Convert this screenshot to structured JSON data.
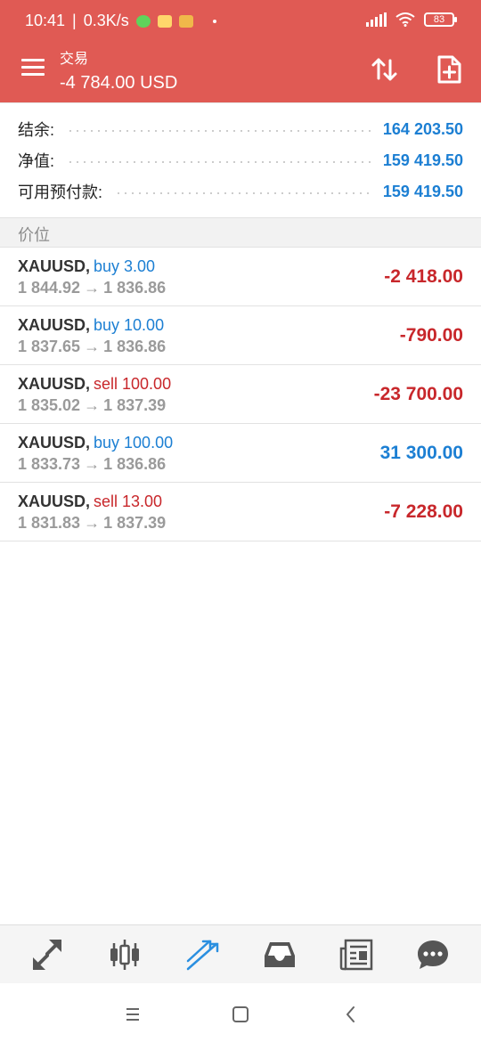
{
  "status_bar": {
    "time": "10:41",
    "speed": "0.3K/s",
    "battery": "83"
  },
  "header": {
    "title": "交易",
    "profit": "-4 784.00 USD",
    "icons": [
      "menu-icon",
      "sort-arrows-icon",
      "new-order-icon"
    ]
  },
  "summary": {
    "rows": [
      {
        "label": "结余:",
        "value": "164 203.50"
      },
      {
        "label": "净值:",
        "value": "159 419.50"
      },
      {
        "label": "可用预付款:",
        "value": "159 419.50"
      }
    ]
  },
  "section": {
    "title": "价位"
  },
  "positions": [
    {
      "symbol": "XAUUSD,",
      "type": "buy 3.00",
      "direction": "buy",
      "open": "1 844.92",
      "current": "1 836.86",
      "profit": "-2 418.00",
      "profit_sign": "negative"
    },
    {
      "symbol": "XAUUSD,",
      "type": "buy 10.00",
      "direction": "buy",
      "open": "1 837.65",
      "current": "1 836.86",
      "profit": "-790.00",
      "profit_sign": "negative"
    },
    {
      "symbol": "XAUUSD,",
      "type": "sell 100.00",
      "direction": "sell",
      "open": "1 835.02",
      "current": "1 837.39",
      "profit": "-23 700.00",
      "profit_sign": "negative"
    },
    {
      "symbol": "XAUUSD,",
      "type": "buy 100.00",
      "direction": "buy",
      "open": "1 833.73",
      "current": "1 836.86",
      "profit": "31 300.00",
      "profit_sign": "positive"
    },
    {
      "symbol": "XAUUSD,",
      "type": "sell 13.00",
      "direction": "sell",
      "open": "1 831.83",
      "current": "1 837.39",
      "profit": "-7 228.00",
      "profit_sign": "negative"
    }
  ],
  "arrow_glyph": "→",
  "bottom_nav": {
    "items": [
      "quotes-icon",
      "chart-candlestick-icon",
      "trade-icon",
      "inbox-icon",
      "news-icon",
      "chat-icon"
    ],
    "active": "trade-icon"
  },
  "colors": {
    "header": "#e05a54",
    "negative": "#c8272b",
    "positive": "#1c7fd3",
    "buy": "#1c7fd3",
    "sell": "#c8272b"
  }
}
